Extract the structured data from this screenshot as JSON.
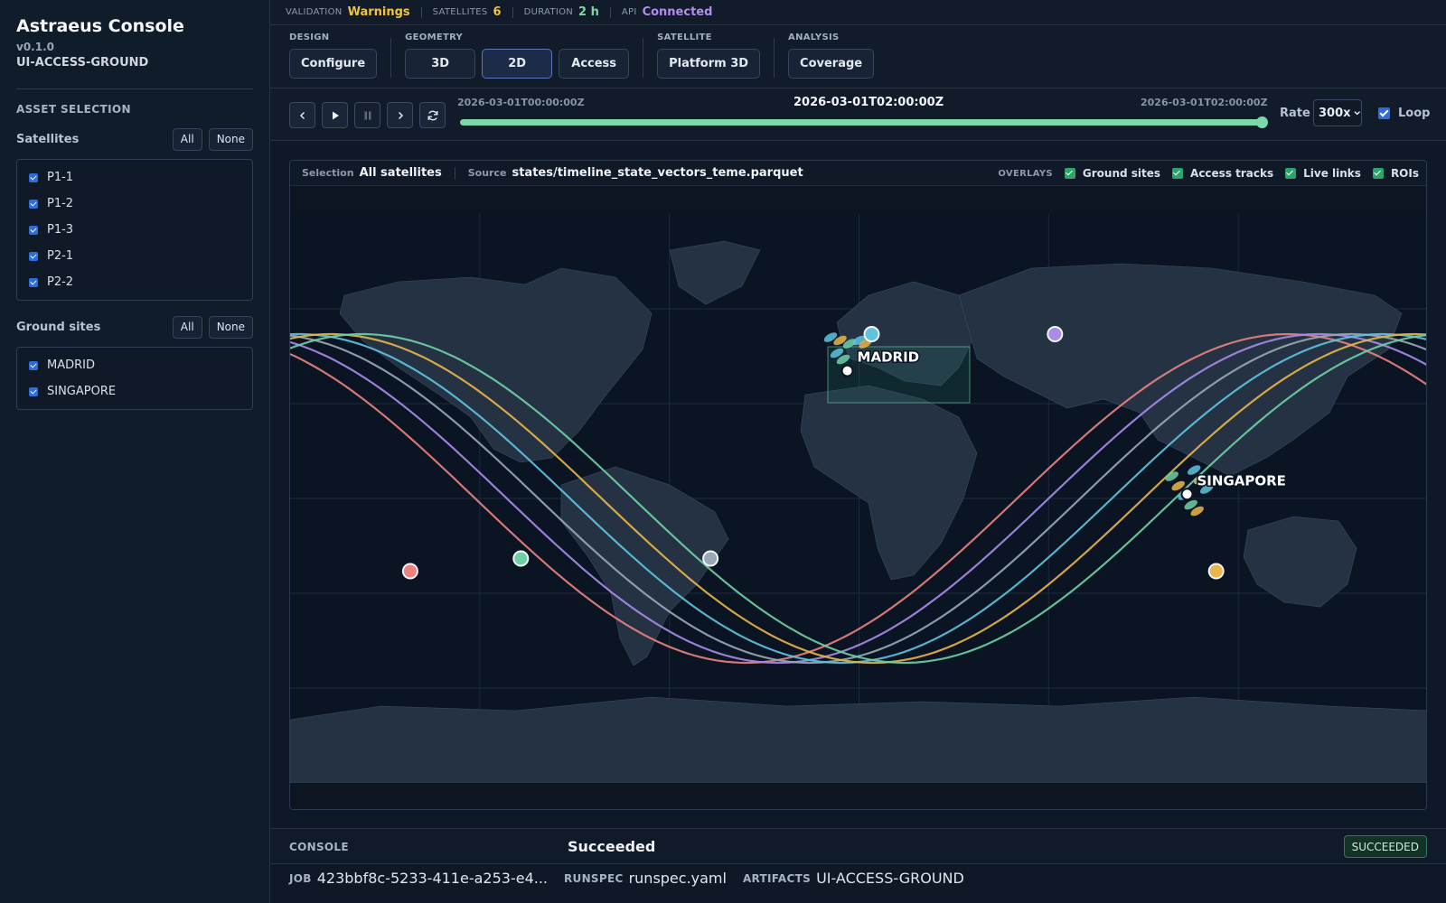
{
  "app": {
    "title": "Astraeus Console",
    "version": "v0.1.0",
    "profile": "UI-ACCESS-GROUND"
  },
  "sidebar": {
    "section_title": "ASSET SELECTION",
    "satellites": {
      "label": "Satellites",
      "all": "All",
      "none": "None",
      "items": [
        "P1-1",
        "P1-2",
        "P1-3",
        "P2-1",
        "P2-2"
      ]
    },
    "ground_sites": {
      "label": "Ground sites",
      "all": "All",
      "none": "None",
      "items": [
        "MADRID",
        "SINGAPORE"
      ]
    }
  },
  "status": {
    "validation_label": "VALIDATION",
    "validation_value": "Warnings",
    "satellites_label": "SATELLITES",
    "satellites_value": "6",
    "duration_label": "DURATION",
    "duration_value": "2 h",
    "api_label": "API",
    "api_value": "Connected",
    "colors": {
      "warnings": "#f0c43f",
      "count": "#f0c43f",
      "duration": "#7bd8a8",
      "api": "#b48cf0"
    }
  },
  "toolbar": {
    "design": {
      "title": "DESIGN",
      "buttons": [
        "Configure"
      ]
    },
    "geometry": {
      "title": "GEOMETRY",
      "buttons": [
        "3D",
        "2D",
        "Access"
      ],
      "active": "2D"
    },
    "satellite": {
      "title": "SATELLITE",
      "buttons": [
        "Platform 3D"
      ]
    },
    "analysis": {
      "title": "ANALYSIS",
      "buttons": [
        "Coverage"
      ]
    }
  },
  "playback": {
    "start_time": "2026-03-01T00:00:00Z",
    "current_time": "2026-03-01T02:00:00Z",
    "end_time": "2026-03-01T02:00:00Z",
    "progress": 1.0,
    "rate_label": "Rate",
    "rate_value": "300x",
    "loop_label": "Loop",
    "loop_checked": true,
    "icons": [
      "step-back-icon",
      "play-icon",
      "pause-icon",
      "step-forward-icon",
      "refresh-icon"
    ]
  },
  "map": {
    "selection_label": "Selection",
    "selection_value": "All satellites",
    "source_label": "Source",
    "source_value": "states/timeline_state_vectors_teme.parquet",
    "overlays_title": "OVERLAYS",
    "overlays": [
      "Ground sites",
      "Access tracks",
      "Live links",
      "ROIs"
    ],
    "sites": [
      {
        "name": "MADRID",
        "lat": 40.4,
        "lon": -3.7
      },
      {
        "name": "SINGAPORE",
        "lat": 1.35,
        "lon": 103.8
      }
    ],
    "track_colors": [
      "#e8837f",
      "#a98bea",
      "#9aa7b6",
      "#5fc3e0",
      "#e8b64a",
      "#6fd0a6"
    ],
    "satellite_markers": [
      {
        "color": "#e8837f",
        "lat": -23,
        "lon": -142
      },
      {
        "color": "#6fd0a6",
        "lat": -19,
        "lon": -107
      },
      {
        "color": "#9aa7b6",
        "lat": -19,
        "lon": -47
      },
      {
        "color": "#5fc3e0",
        "lat": 52,
        "lon": 4
      },
      {
        "color": "#a98bea",
        "lat": 52,
        "lon": 62
      },
      {
        "color": "#e8b64a",
        "lat": -23,
        "lon": 113
      }
    ]
  },
  "console": {
    "label": "CONSOLE",
    "status": "Succeeded",
    "badge": "SUCCEEDED",
    "job_label": "JOB",
    "job_value": "423bbf8c-5233-411e-a253-e4...",
    "runspec_label": "RUNSPEC",
    "runspec_value": "runspec.yaml",
    "artifacts_label": "ARTIFACTS",
    "artifacts_value": "UI-ACCESS-GROUND"
  }
}
